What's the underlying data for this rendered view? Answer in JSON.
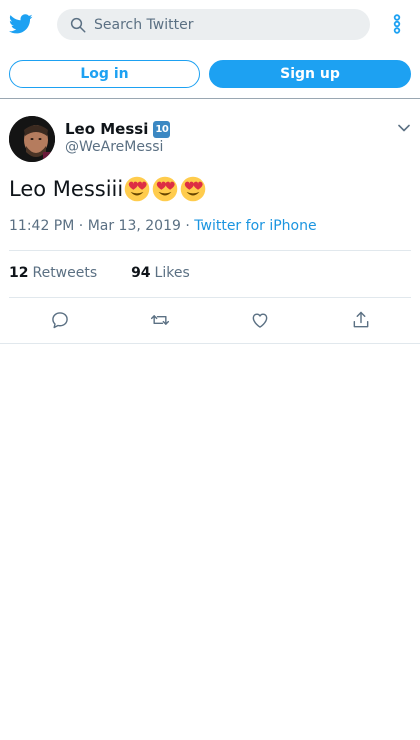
{
  "header": {
    "logo_icon": "twitter-bird-icon",
    "search_placeholder": "Search Twitter",
    "search_icon": "search-icon",
    "more_icon": "more-vertical-icon",
    "brand_color": "#1da1f2"
  },
  "auth": {
    "login_label": "Log in",
    "signup_label": "Sign up"
  },
  "tweet": {
    "author_name": "Leo Messi",
    "author_badge": "10",
    "handle": "@WeAreMessi",
    "text": "Leo Messiii",
    "emojis": [
      "heart-eyes-emoji",
      "heart-eyes-emoji",
      "heart-eyes-emoji"
    ],
    "time": "11:42 PM",
    "separator": "·",
    "date": "Mar 13, 2019",
    "source": "Twitter for iPhone",
    "retweets_count": "12",
    "retweets_label": "Retweets",
    "likes_count": "94",
    "likes_label": "Likes"
  },
  "actions": {
    "reply_icon": "reply-icon",
    "retweet_icon": "retweet-icon",
    "like_icon": "heart-icon",
    "share_icon": "share-icon"
  }
}
